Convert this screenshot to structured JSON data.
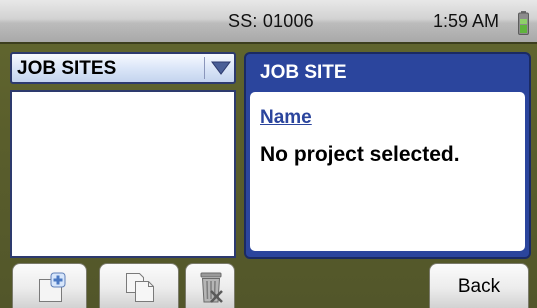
{
  "status_bar": {
    "serial": "SS: 01006",
    "time": "1:59 AM",
    "battery_icon": "battery-icon"
  },
  "sites_dropdown": {
    "selected": "JOB SITES",
    "icon": "chevron-down-icon"
  },
  "sites_list": {
    "items": []
  },
  "job_site_panel": {
    "title": "JOB SITE",
    "field_label": "Name",
    "field_value": "No project selected."
  },
  "toolbar": {
    "add_icon": "add-document-icon",
    "copy_icon": "copy-icon",
    "delete_icon": "trash-icon",
    "back_label": "Back"
  },
  "colors": {
    "background": "#5a5e2c",
    "panel_blue": "#2b459d",
    "link_blue": "#2b459d",
    "battery_green": "#5fb43c"
  }
}
